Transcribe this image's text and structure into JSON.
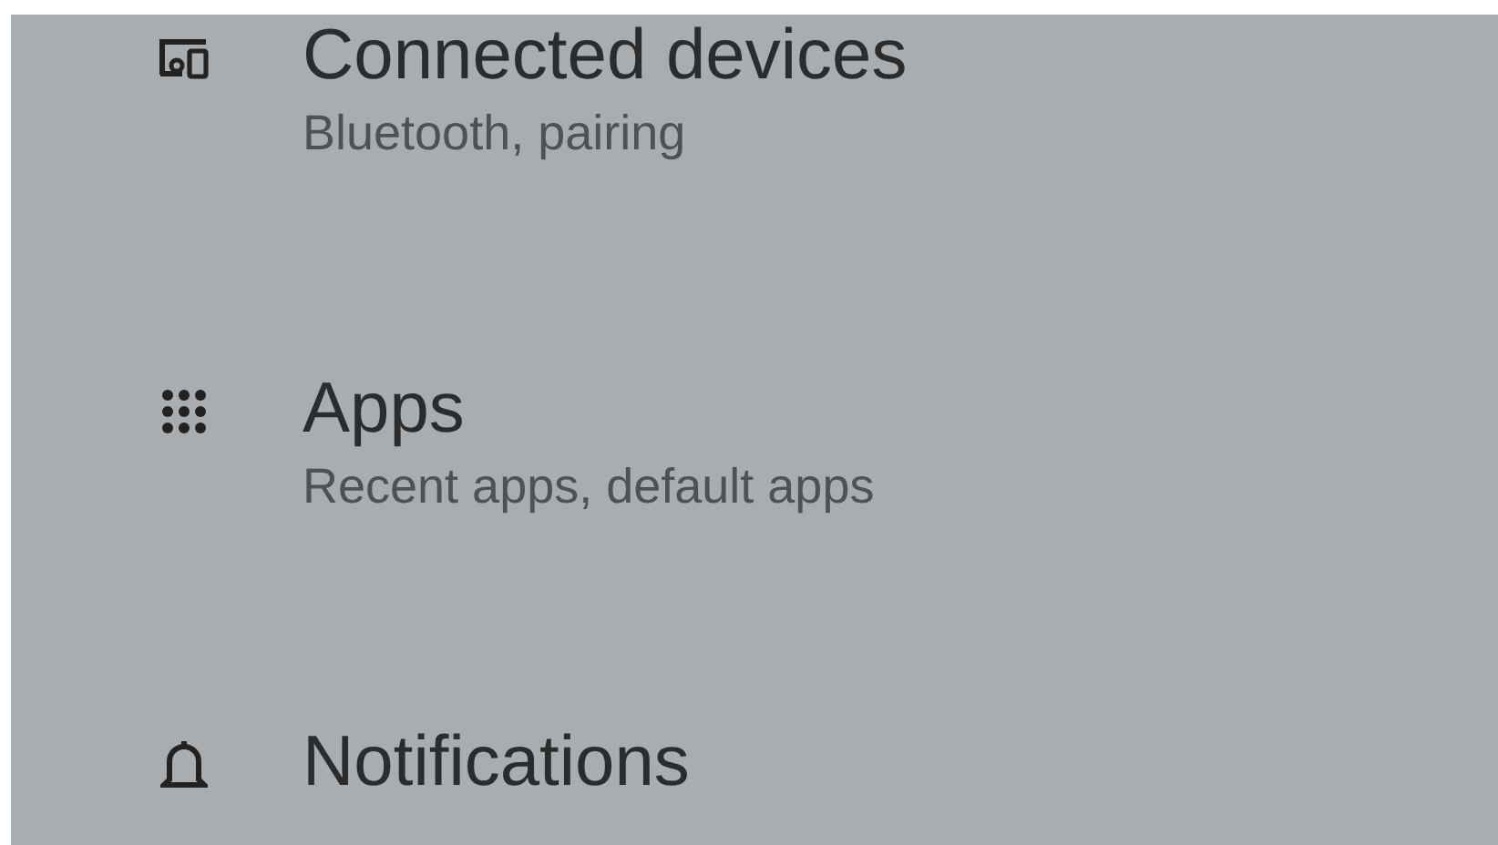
{
  "settings_items": [
    {
      "kind": "devices",
      "title": "Connected devices",
      "subtitle": "Bluetooth, pairing"
    },
    {
      "kind": "apps",
      "title": "Apps",
      "subtitle": "Recent apps, default apps"
    },
    {
      "kind": "notifications",
      "title": "Notifications"
    }
  ]
}
